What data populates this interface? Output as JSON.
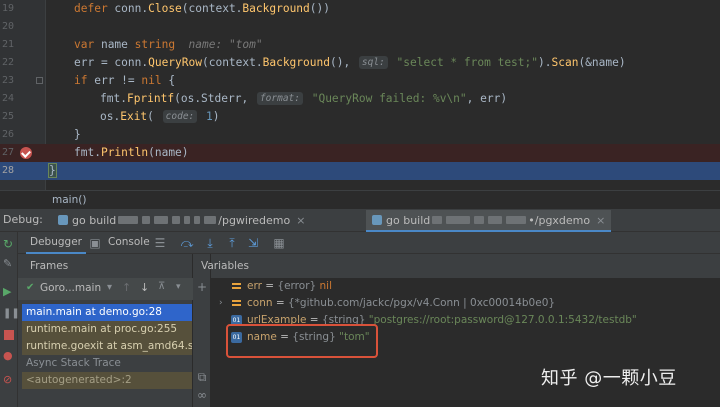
{
  "editor": {
    "lines": [
      {
        "num": "19"
      },
      {
        "num": "20"
      },
      {
        "num": "21"
      },
      {
        "num": "22"
      },
      {
        "num": "23"
      },
      {
        "num": "24"
      },
      {
        "num": "25"
      },
      {
        "num": "26"
      },
      {
        "num": "27"
      },
      {
        "num": "28"
      }
    ],
    "code": {
      "l19_kw": "defer",
      "l19_a": " conn.",
      "l19_fn": "Close",
      "l19_b": "(context.",
      "l19_fn2": "Background",
      "l19_c": "())",
      "l21_kw": "var",
      "l21_a": " name ",
      "l21_kw2": "string",
      "l21_inline": "  name: \"tom\"",
      "l22_a": "err = conn.",
      "l22_fn": "QueryRow",
      "l22_b": "(context.",
      "l22_fn2": "Background",
      "l22_c": "(), ",
      "l22_hint": "sql:",
      "l22_str": " \"select * from test;\"",
      "l22_d": ").",
      "l22_fn3": "Scan",
      "l22_e": "(&name)",
      "l23_kw": "if",
      "l23_a": " err != ",
      "l23_kw2": "nil",
      "l23_b": " {",
      "l24_a": "fmt.",
      "l24_fn": "Fprintf",
      "l24_b": "(os.Stderr, ",
      "l24_hint": "format:",
      "l24_str": " \"QueryRow failed: %v\\n\"",
      "l24_c": ", err)",
      "l25_a": "os.",
      "l25_fn": "Exit",
      "l25_b": "( ",
      "l25_hint": "code:",
      "l25_num": " 1",
      "l25_c": ")",
      "l26_a": "}",
      "l27_a": "fmt.",
      "l27_fn": "Println",
      "l27_b": "(name)",
      "l28_a": "}"
    },
    "breadcrumb": "main()"
  },
  "debug": {
    "label": "Debug:",
    "tabs": [
      {
        "prefix": "go build",
        "suffix": "/pgwiredemo",
        "close": "×"
      },
      {
        "prefix": "go build",
        "suffix": "•/pgxdemo",
        "close": "×"
      }
    ],
    "subtabs": {
      "debugger": "Debugger",
      "console": "Console"
    }
  },
  "frames": {
    "title": "Frames",
    "thread": "Goro...main",
    "rows": [
      "main.main at demo.go:28",
      "runtime.main at proc.go:255",
      "runtime.goexit at asm_amd64.s",
      "Async Stack Trace",
      "<autogenerated>:2"
    ]
  },
  "variables": {
    "title": "Variables",
    "rows": [
      {
        "name": "err",
        "eq": " = ",
        "type": "{error}",
        "value": " nil"
      },
      {
        "name": "conn",
        "eq": " = ",
        "type": "{*github.com/jackc/pgx/v4.Conn | 0xc00014b0e0}",
        "value": ""
      },
      {
        "name": "urlExample",
        "eq": " = ",
        "type": "{string}",
        "value": " \"postgres://root:password@127.0.0.1:5432/testdb\""
      },
      {
        "name": "name",
        "eq": " = ",
        "type": "{string}",
        "value": " \"tom\""
      }
    ]
  },
  "watermark": "知乎 @一颗小豆",
  "colors": {
    "breakpoint": "#c75450",
    "current_line": "#2d4a7a",
    "highlight_box": "#d9523a",
    "selection": "#2f65ca"
  }
}
